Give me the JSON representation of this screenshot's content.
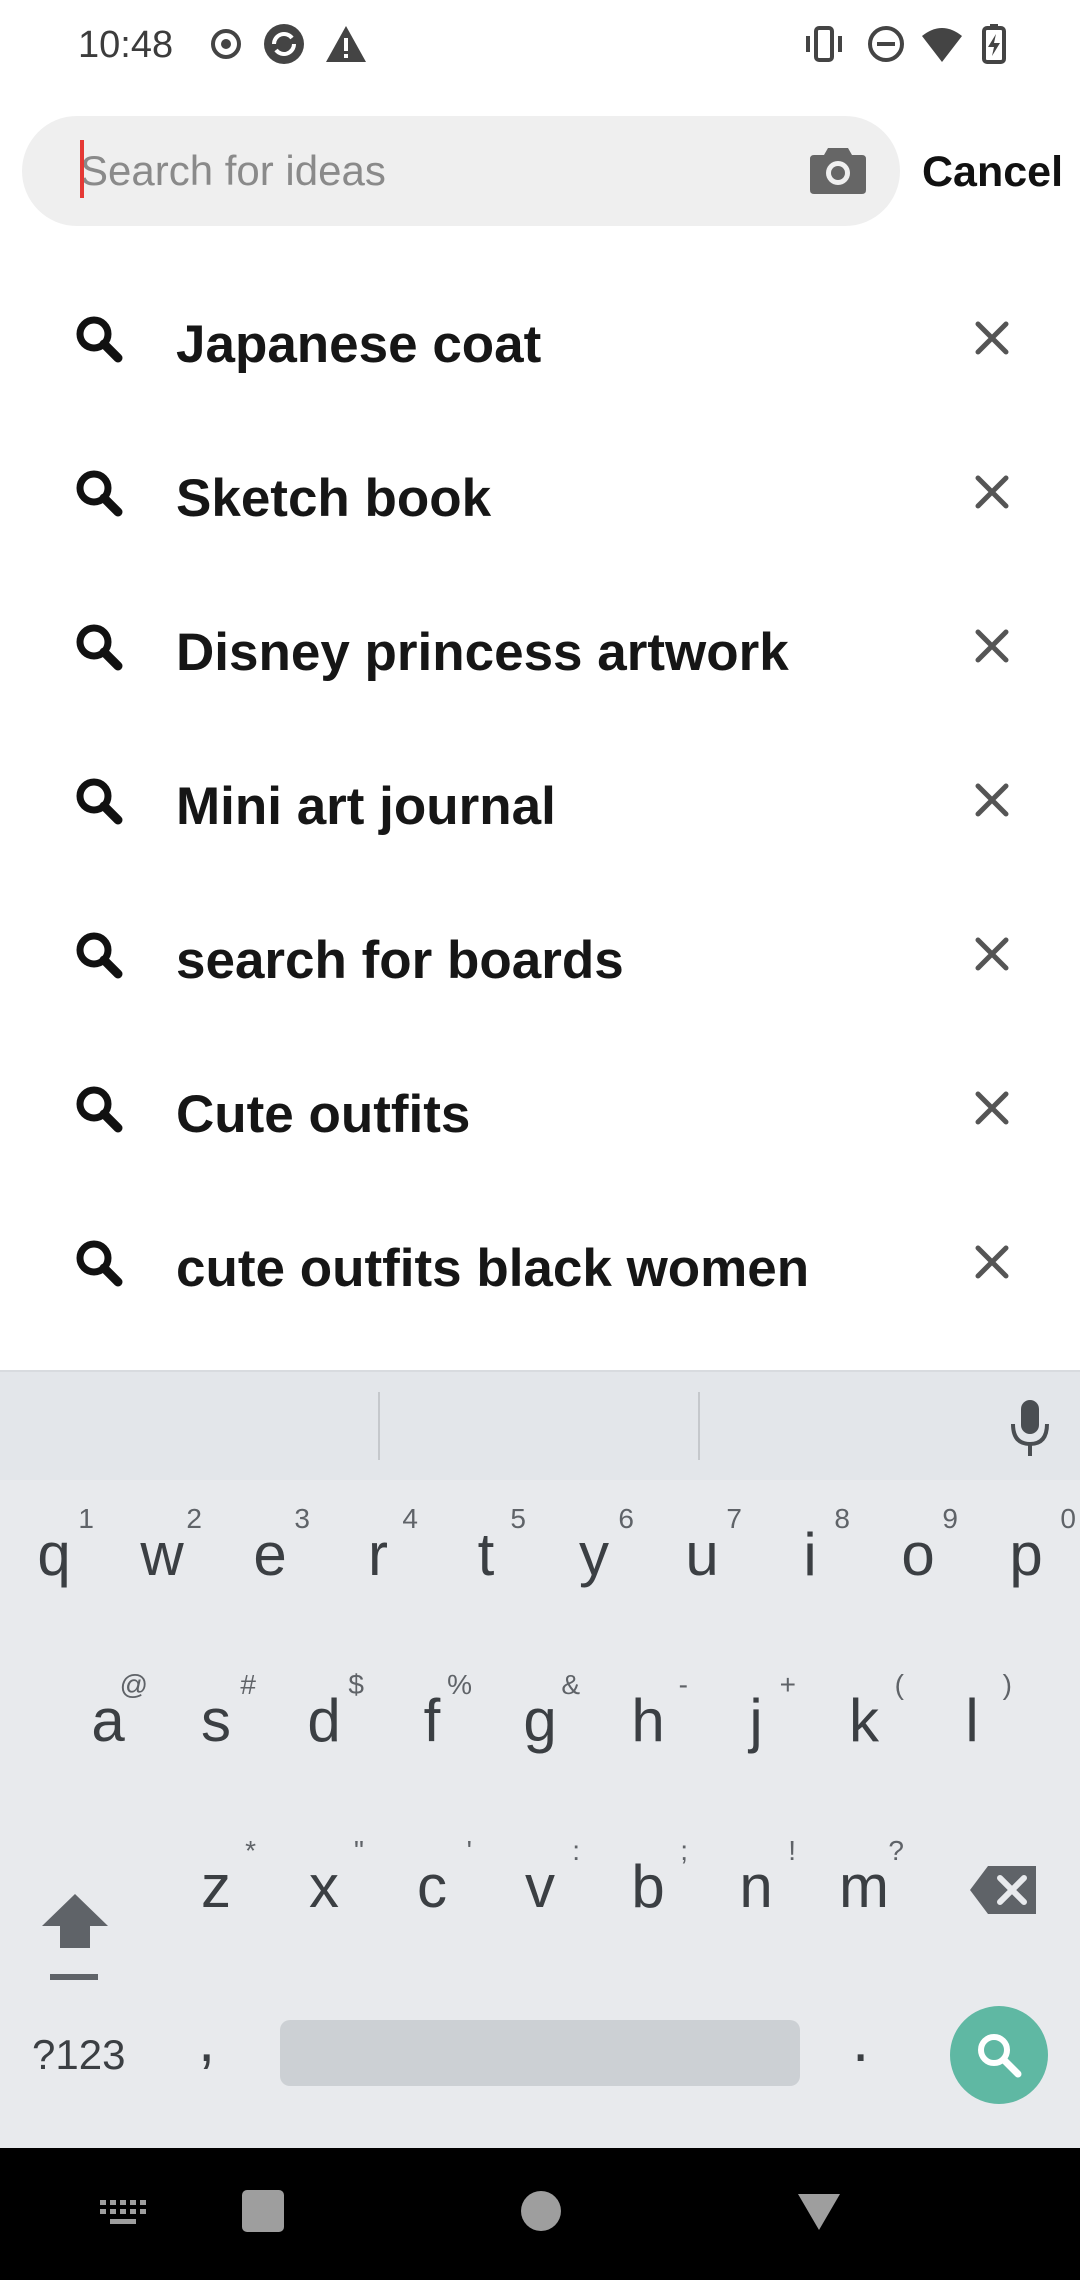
{
  "status_bar": {
    "time": "10:48",
    "left_icons": [
      "record-icon",
      "sync-icon",
      "warning-icon"
    ],
    "right_icons": [
      "vibrate-icon",
      "dnd-icon",
      "wifi-icon",
      "battery-icon"
    ]
  },
  "search": {
    "placeholder": "Search for ideas",
    "value": "",
    "camera_icon": "camera-icon",
    "cancel_label": "Cancel"
  },
  "suggestions": [
    {
      "label": "Japanese coat"
    },
    {
      "label": "Sketch book"
    },
    {
      "label": "Disney princess artwork"
    },
    {
      "label": "Mini art journal"
    },
    {
      "label": "search for boards"
    },
    {
      "label": "Cute outfits"
    },
    {
      "label": "cute outfits black women"
    }
  ],
  "keyboard": {
    "row1": [
      {
        "key": "q",
        "alt": "1"
      },
      {
        "key": "w",
        "alt": "2"
      },
      {
        "key": "e",
        "alt": "3"
      },
      {
        "key": "r",
        "alt": "4"
      },
      {
        "key": "t",
        "alt": "5"
      },
      {
        "key": "y",
        "alt": "6"
      },
      {
        "key": "u",
        "alt": "7"
      },
      {
        "key": "i",
        "alt": "8"
      },
      {
        "key": "o",
        "alt": "9"
      },
      {
        "key": "p",
        "alt": "0"
      }
    ],
    "row2": [
      {
        "key": "a",
        "alt": "@"
      },
      {
        "key": "s",
        "alt": "#"
      },
      {
        "key": "d",
        "alt": "$"
      },
      {
        "key": "f",
        "alt": "%"
      },
      {
        "key": "g",
        "alt": "&"
      },
      {
        "key": "h",
        "alt": "-"
      },
      {
        "key": "j",
        "alt": "+"
      },
      {
        "key": "k",
        "alt": "("
      },
      {
        "key": "l",
        "alt": ")"
      }
    ],
    "row3": [
      {
        "key": "z",
        "alt": "*"
      },
      {
        "key": "x",
        "alt": "\""
      },
      {
        "key": "c",
        "alt": "'"
      },
      {
        "key": "v",
        "alt": ":"
      },
      {
        "key": "b",
        "alt": ";"
      },
      {
        "key": "n",
        "alt": "!"
      },
      {
        "key": "m",
        "alt": "?"
      }
    ],
    "symbols_label": "?123",
    "comma": ",",
    "period": ".",
    "accent_color": "#5fb8a3"
  },
  "nav_bar": {
    "buttons": [
      "keyboard-icon",
      "recents-icon",
      "home-icon",
      "back-icon"
    ]
  }
}
